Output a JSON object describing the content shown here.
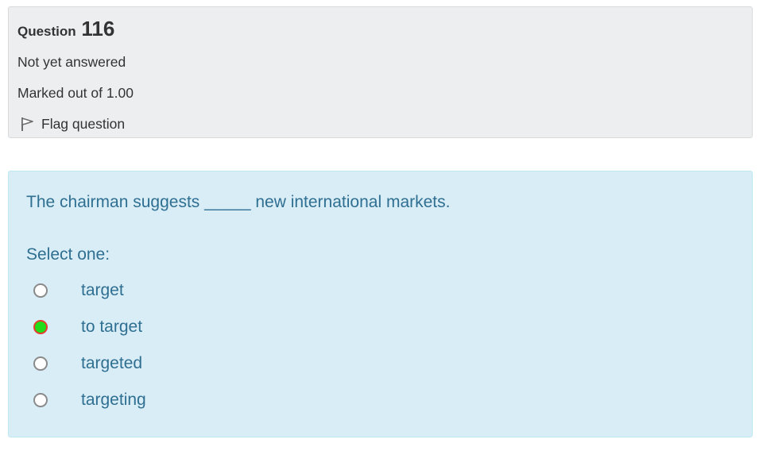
{
  "info": {
    "question_prefix": "Question",
    "question_number": "116",
    "state": "Not yet answered",
    "grade": "Marked out of 1.00",
    "flag_label": "Flag question"
  },
  "question": {
    "text": "The chairman suggests _____ new international markets.",
    "prompt": "Select one:",
    "selected_index": 1,
    "options": [
      {
        "label": "target"
      },
      {
        "label": "to target"
      },
      {
        "label": "targeted"
      },
      {
        "label": "targeting"
      }
    ]
  },
  "colors": {
    "selected_fill": "#22dd1a",
    "selected_border": "#e53e2e",
    "text_blue": "#2f6f91",
    "content_bg": "#d9edf7",
    "info_bg": "#eceef0"
  }
}
